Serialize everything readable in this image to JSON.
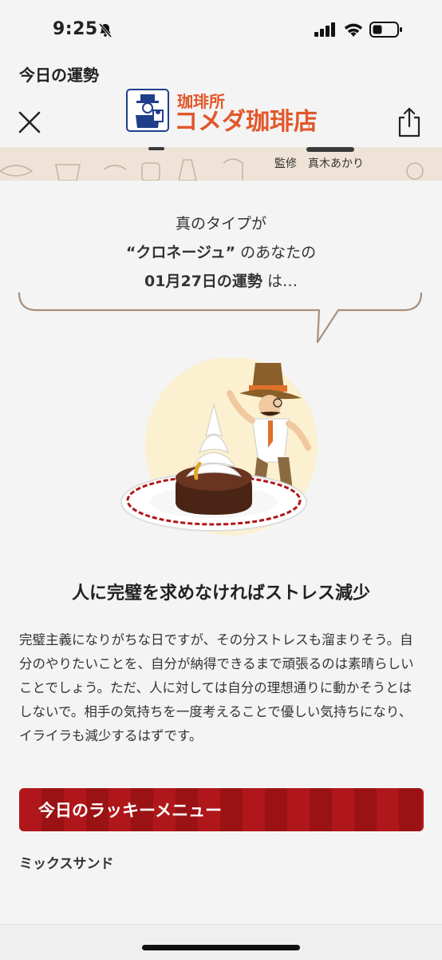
{
  "status": {
    "time": "9:25"
  },
  "app": {
    "page_title": "今日の運勢"
  },
  "logo": {
    "top_text": "珈琲所",
    "main_text": "コメダ珈琲店"
  },
  "banner": {
    "supervisor": "監修　真木あかり"
  },
  "intro": {
    "line1": "真のタイプが",
    "type_name": "“クロネージュ”",
    "line2_suffix": " のあなたの",
    "date_label": "01月27日の運勢",
    "line3_suffix": " は…"
  },
  "fortune": {
    "heading": "人に完璧を求めなければストレス減少",
    "body": "完璧主義になりがちな日ですが、その分ストレスも溜まりそう。自分のやりたいことを、自分が納得できるまで頑張るのは素晴らしいことでしょう。ただ、人に対しては自分の理想通りに動かそうとはしないで。相手の気持ちを一度考えることで優しい気持ちになり、イライラも減少するはずです。"
  },
  "lucky": {
    "title": "今日のラッキーメニュー",
    "item": "ミックスサンド"
  },
  "colors": {
    "accent_red": "#b0171a",
    "logo_orange": "#e2572a",
    "logo_blue": "#1f3f8a",
    "background": "#f4f4f4"
  }
}
